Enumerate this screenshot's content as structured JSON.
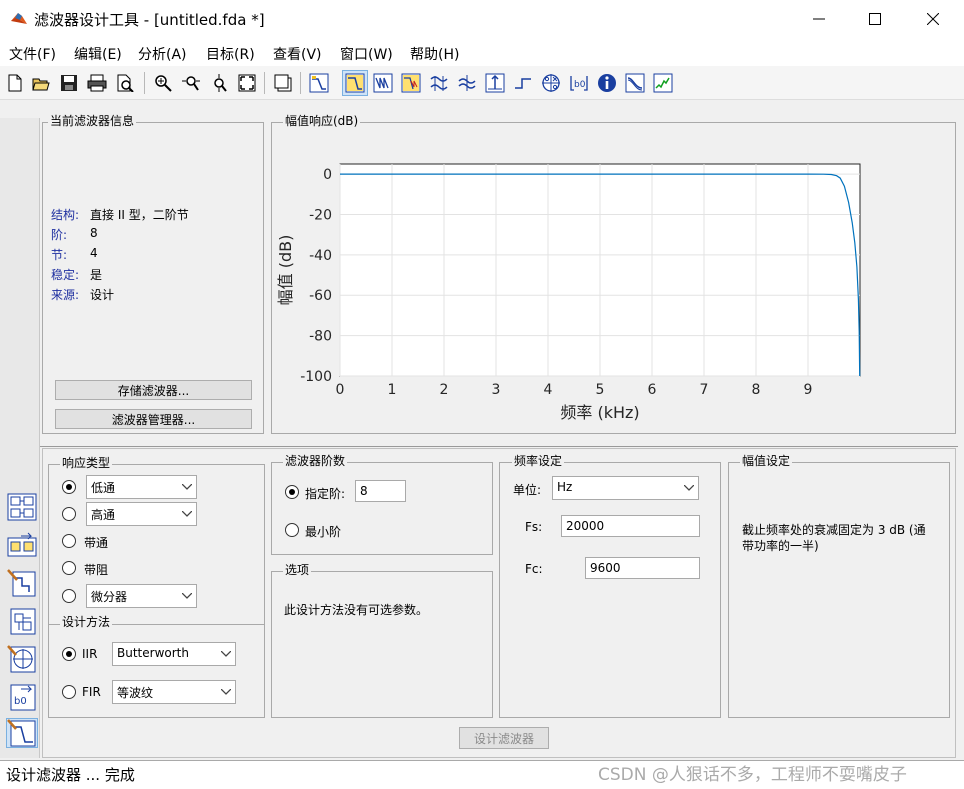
{
  "window": {
    "title": "滤波器设计工具 -  [untitled.fda *]",
    "controls": [
      "minimize",
      "maximize",
      "close"
    ]
  },
  "menu": [
    "文件(F)",
    "编辑(E)",
    "分析(A)",
    "目标(R)",
    "查看(V)",
    "窗口(W)",
    "帮助(H)"
  ],
  "toolbar_icons": [
    "new-icon",
    "open-icon",
    "save-icon",
    "print-icon",
    "print-preview-icon",
    "zoom-in-icon",
    "zoom-x-icon",
    "zoom-y-icon",
    "full-view-icon",
    "new-window-icon",
    "filter-spec-icon",
    "magnitude-response-icon",
    "phase-response-icon",
    "mag-phase-icon",
    "group-delay-icon",
    "phase-delay-icon",
    "impulse-response-icon",
    "step-response-icon",
    "pole-zero-icon",
    "filter-coeff-icon",
    "info-icon",
    "magnitude-estimate-icon",
    "noise-psd-icon"
  ],
  "current_filter": {
    "title": "当前滤波器信息",
    "rows": [
      {
        "label": "结构:",
        "value": "直接 II 型，二阶节"
      },
      {
        "label": "阶:",
        "value": "8"
      },
      {
        "label": "节:",
        "value": "4"
      },
      {
        "label": "稳定:",
        "value": "是"
      },
      {
        "label": "来源:",
        "value": "设计"
      }
    ],
    "store_button": "存储滤波器...",
    "manager_button": "滤波器管理器..."
  },
  "magnitude_panel": {
    "title": "幅值响应(dB)"
  },
  "chart_data": {
    "type": "line",
    "title": "",
    "xlabel": "频率 (kHz)",
    "ylabel": "幅值 (dB)",
    "xlim": [
      0,
      10
    ],
    "ylim": [
      -100,
      5
    ],
    "xticks": [
      0,
      1,
      2,
      3,
      4,
      5,
      6,
      7,
      8,
      9
    ],
    "yticks": [
      0,
      -20,
      -40,
      -60,
      -80,
      -100
    ],
    "grid": true,
    "line_color": "#0072bd",
    "x": [
      0,
      1,
      2,
      3,
      4,
      5,
      6,
      7,
      8,
      9,
      9.3,
      9.45,
      9.55,
      9.62,
      9.7,
      9.78,
      9.85,
      9.9,
      9.94,
      9.97,
      9.985,
      9.995
    ],
    "y": [
      0,
      0,
      0,
      0,
      0,
      0,
      0,
      0,
      0,
      0,
      -0.05,
      -0.2,
      -0.8,
      -2,
      -6,
      -14,
      -24,
      -34,
      -46,
      -62,
      -78,
      -100
    ]
  },
  "response_type": {
    "title": "响应类型",
    "options": [
      {
        "label": "",
        "selected": true,
        "select_value": "低通"
      },
      {
        "label": "",
        "selected": false,
        "select_value": "高通"
      },
      {
        "label": "带通",
        "selected": false
      },
      {
        "label": "带阻",
        "selected": false
      },
      {
        "label": "",
        "selected": false,
        "select_value": "微分器"
      }
    ]
  },
  "design_method": {
    "title": "设计方法",
    "iir_label": "IIR",
    "iir_value": "Butterworth",
    "fir_label": "FIR",
    "fir_value": "等波纹",
    "selected": "IIR"
  },
  "filter_order": {
    "title": "滤波器阶数",
    "specify_label": "指定阶:",
    "specify_value": "8",
    "minimum_label": "最小阶",
    "selected": "specify"
  },
  "options": {
    "title": "选项",
    "text": "此设计方法没有可选参数。"
  },
  "frequency_spec": {
    "title": "频率设定",
    "units_label": "单位:",
    "units_value": "Hz",
    "fs_label": "Fs:",
    "fs_value": "20000",
    "fc_label": "Fc:",
    "fc_value": "9600"
  },
  "magnitude_spec": {
    "title": "幅值设定",
    "text_line1": "截止频率处的衰减固定为 3 dB (通",
    "text_line2": "带功率的一半)"
  },
  "design_button": "设计滤波器",
  "status": "设计滤波器 ... 完成",
  "watermark": "CSDN @人狠话不多，工程师不耍嘴皮子"
}
